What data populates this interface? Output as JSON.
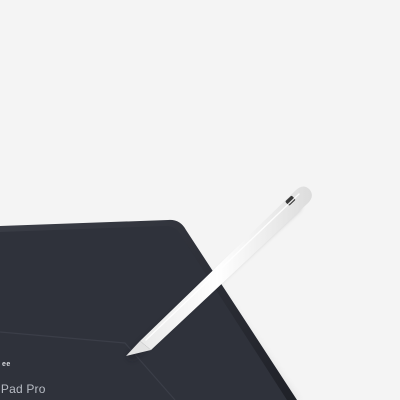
{
  "scene": {
    "background_color": "#f4f4f4",
    "device": {
      "type": "tablet",
      "body_color": "#2b2e36",
      "screen_color": "#2f323b",
      "screen_text": {
        "logo_line": "ee",
        "model_line": "iPad Pro"
      }
    },
    "stylus": {
      "type": "stylus-pencil",
      "body_color": "#f7f7f7",
      "cap_band_color": "#3a3a3a",
      "tip_color": "#d9d9d9"
    }
  }
}
